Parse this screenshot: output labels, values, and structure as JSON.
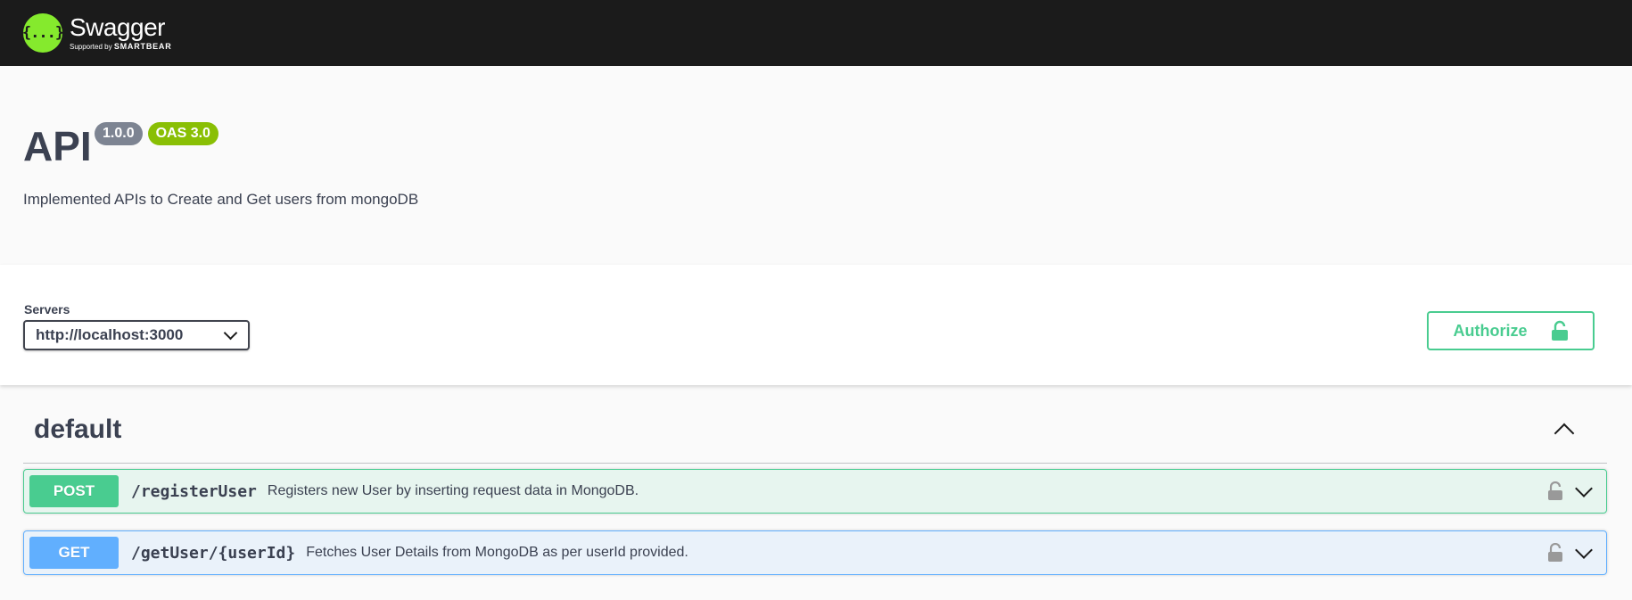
{
  "topbar": {
    "logo_name": "Swagger",
    "logo_sub_prefix": "Supported by",
    "logo_sub_brand": "SMARTBEAR",
    "logo_glyph": "{...}"
  },
  "info": {
    "title": "API",
    "version": "1.0.0",
    "oas": "OAS 3.0",
    "description": "Implemented APIs to Create and Get users from mongoDB"
  },
  "servers": {
    "label": "Servers",
    "selected": "http://localhost:3000"
  },
  "authorize": {
    "label": "Authorize"
  },
  "tag": {
    "name": "default"
  },
  "operations": [
    {
      "method": "POST",
      "path": "/registerUser",
      "summary": "Registers new User by inserting request data in MongoDB."
    },
    {
      "method": "GET",
      "path": "/getUser/{userId}",
      "summary": "Fetches User Details from MongoDB as per userId provided."
    }
  ],
  "colors": {
    "post": "#49cc90",
    "get": "#61afe",
    "topbar": "#1b1b1b",
    "logo": "#85ea2d",
    "oas_badge": "#89bf04",
    "version_badge": "#7d8492"
  }
}
